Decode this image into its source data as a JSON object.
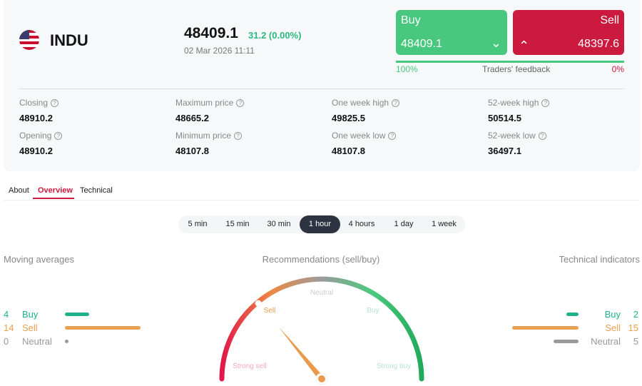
{
  "instrument": {
    "symbol": "INDU",
    "flag_icon": "us-flag-icon",
    "price": "48409.1",
    "change": "31.2 (0.00%)",
    "datetime": "02 Mar 2026 11:11"
  },
  "trade": {
    "buy_label": "Buy",
    "buy_price": "48409.1",
    "sell_label": "Sell",
    "sell_price": "48397.6",
    "feedback_label": "Traders' feedback",
    "buy_pct": "100%",
    "sell_pct": "0%",
    "buy_fraction": 1.0
  },
  "stats": [
    {
      "label": "Closing",
      "value": "48910.2"
    },
    {
      "label": "Maximum price",
      "value": "48665.2"
    },
    {
      "label": "One week high",
      "value": "49825.5"
    },
    {
      "label": "52-week high",
      "value": "50514.5"
    },
    {
      "label": "Opening",
      "value": "48910.2"
    },
    {
      "label": "Minimum price",
      "value": "48107.8"
    },
    {
      "label": "One week low",
      "value": "48107.8"
    },
    {
      "label": "52-week low",
      "value": "36497.1"
    }
  ],
  "help_glyph": "?",
  "tabs": [
    "About",
    "Overview",
    "Technical"
  ],
  "active_tab": "Overview",
  "timeframes": [
    "5 min",
    "15 min",
    "30 min",
    "1 hour",
    "4 hours",
    "1 day",
    "1 week"
  ],
  "active_timeframe": "1 hour",
  "moving_averages": {
    "title": "Moving averages",
    "rows": [
      {
        "count": "4",
        "label": "Buy"
      },
      {
        "count": "14",
        "label": "Sell"
      },
      {
        "count": "0",
        "label": "Neutral"
      }
    ]
  },
  "gauge": {
    "title": "Recommendations (sell/buy)",
    "labels": {
      "strong_sell": "Strong sell",
      "sell": "Sell",
      "neutral": "Neutral",
      "buy": "Buy",
      "strong_buy": "Strong buy"
    },
    "needle_fraction": 0.28
  },
  "technical_indicators": {
    "title": "Technical indicators",
    "rows": [
      {
        "count": "2",
        "label": "Buy"
      },
      {
        "count": "15",
        "label": "Sell"
      },
      {
        "count": "5",
        "label": "Neutral"
      }
    ]
  },
  "colors": {
    "buy": "#48c87e",
    "sell": "#cc1a3e",
    "ma_buy": "#1fb28a",
    "ma_sell": "#e9a04f",
    "neutral": "#999999"
  }
}
